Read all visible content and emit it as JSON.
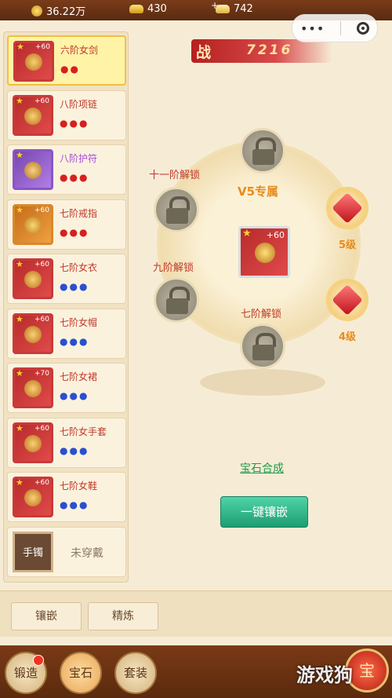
{
  "topbar": {
    "coins": "36.22万",
    "ingots": "430",
    "bound_ingots": "742"
  },
  "power": {
    "label": "战",
    "value": "7216"
  },
  "items": [
    {
      "name": "六阶女剑",
      "level": "+60",
      "gem_color": "red",
      "gem_count": 2,
      "frame": "red",
      "selected": true
    },
    {
      "name": "八阶项链",
      "level": "+60",
      "gem_color": "red",
      "gem_count": 3,
      "frame": "red",
      "selected": false
    },
    {
      "name": "八阶护符",
      "level": "",
      "gem_color": "red",
      "gem_count": 3,
      "frame": "purple",
      "selected": false,
      "name_color": "purple"
    },
    {
      "name": "七阶戒指",
      "level": "+60",
      "gem_color": "red",
      "gem_count": 3,
      "frame": "orange",
      "selected": false
    },
    {
      "name": "七阶女衣",
      "level": "+60",
      "gem_color": "blue",
      "gem_count": 3,
      "frame": "red",
      "selected": false
    },
    {
      "name": "七阶女帽",
      "level": "+60",
      "gem_color": "blue",
      "gem_count": 3,
      "frame": "red",
      "selected": false
    },
    {
      "name": "七阶女裙",
      "level": "+70",
      "gem_color": "blue",
      "gem_count": 3,
      "frame": "red",
      "selected": false
    },
    {
      "name": "七阶女手套",
      "level": "+60",
      "gem_color": "blue",
      "gem_count": 3,
      "frame": "red",
      "selected": false
    },
    {
      "name": "七阶女鞋",
      "level": "+60",
      "gem_color": "blue",
      "gem_count": 3,
      "frame": "red",
      "selected": false
    }
  ],
  "bracelet": {
    "slot": "手镯",
    "status": "未穿戴"
  },
  "slots": {
    "eleven_unlock": "十一阶解锁",
    "nine_unlock": "九阶解锁",
    "seven_unlock": "七阶解锁",
    "vip": "V5专属",
    "gem1_level": "5级",
    "gem2_level": "4级",
    "center_level": "+60"
  },
  "actions": {
    "synthesize": "宝石合成",
    "one_key": "一键镶嵌"
  },
  "subtabs": {
    "inlay": "镶嵌",
    "refine": "精炼"
  },
  "nav": {
    "forge": "锻造",
    "gem": "宝石",
    "set": "套装",
    "round_btn": "宝"
  },
  "watermark": "游戏狗",
  "colors": {
    "accent_red": "#c0392b",
    "gem_blue": "#2a4fd0",
    "synth_green": "#1f9a4a"
  }
}
